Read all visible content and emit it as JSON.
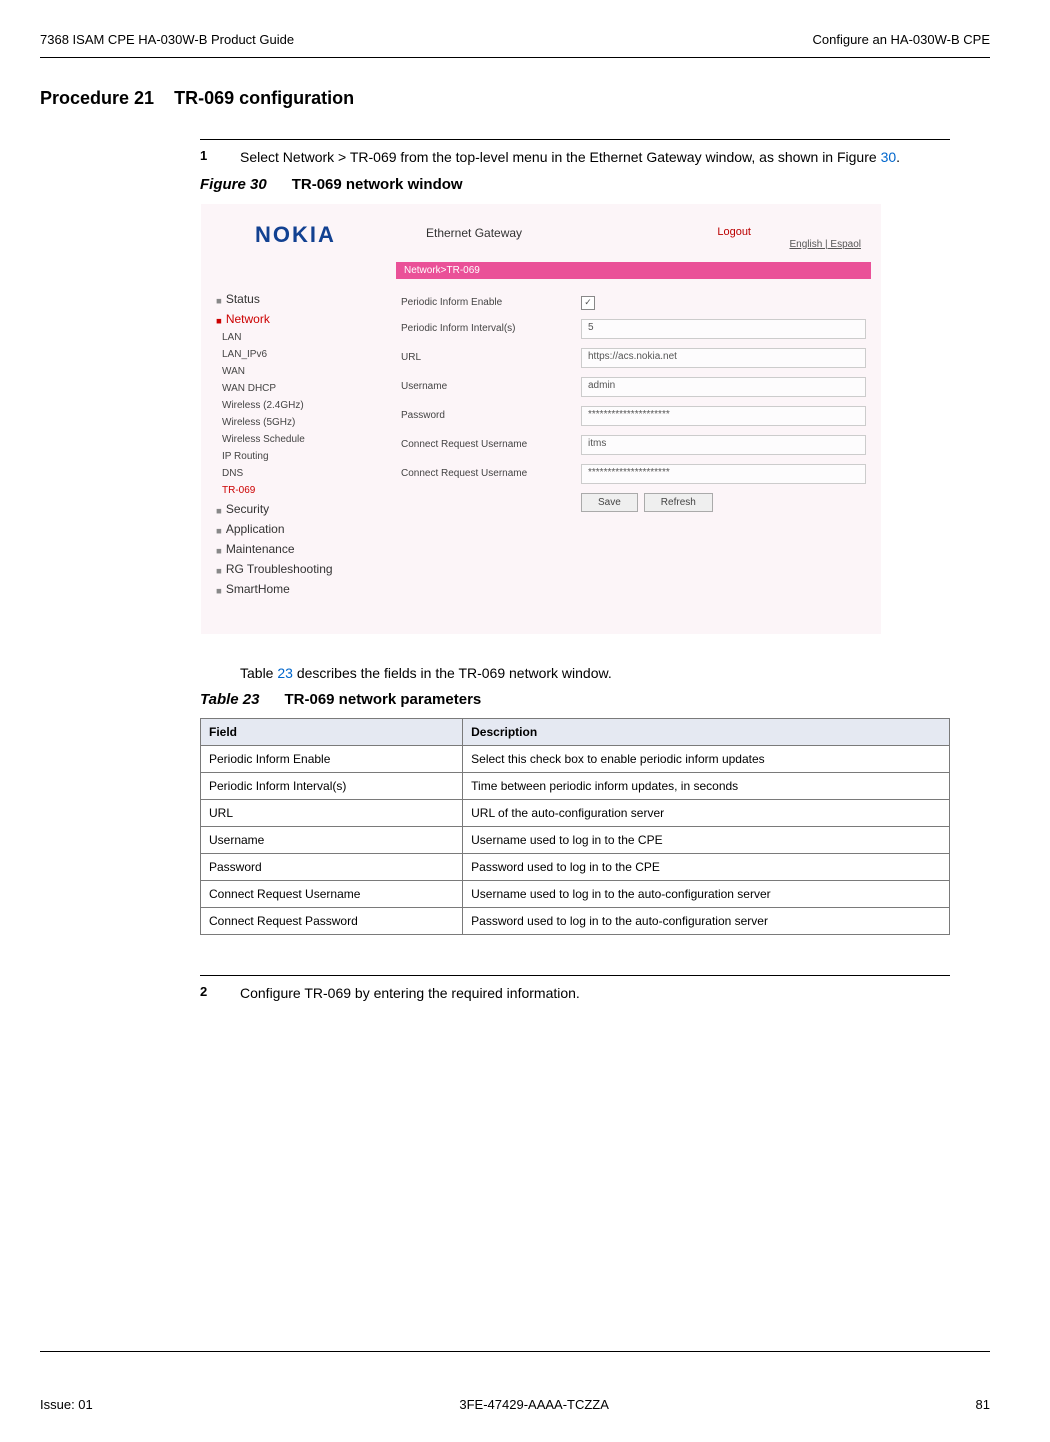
{
  "header": {
    "left": "7368 ISAM CPE HA-030W-B Product Guide",
    "right": "Configure an HA-030W-B CPE"
  },
  "procedure": {
    "label": "Procedure 21",
    "title": "TR-069 configuration"
  },
  "step1": {
    "num": "1",
    "text_before": "Select Network > TR-069 from the top-level menu in the Ethernet Gateway window, as shown in Figure ",
    "ref": "30",
    "text_after": "."
  },
  "figure": {
    "label": "Figure 30",
    "title": "TR-069 network window"
  },
  "screenshot": {
    "logo": "NOKIA",
    "header_title": "Ethernet Gateway",
    "logout": "Logout",
    "lang": "English | Espaol",
    "breadcrumb": "Network>TR-069",
    "side": {
      "status": "Status",
      "network": "Network",
      "items": [
        "LAN",
        "LAN_IPv6",
        "WAN",
        "WAN DHCP",
        "Wireless (2.4GHz)",
        "Wireless (5GHz)",
        "Wireless Schedule",
        "IP Routing",
        "DNS",
        "TR-069"
      ],
      "security": "Security",
      "application": "Application",
      "maintenance": "Maintenance",
      "rg": "RG Troubleshooting",
      "smarthome": "SmartHome"
    },
    "form": {
      "periodic_enable_label": "Periodic Inform Enable",
      "periodic_enable_value": "✓",
      "periodic_interval_label": "Periodic Inform Interval(s)",
      "periodic_interval_value": "5",
      "url_label": "URL",
      "url_value": "https://acs.nokia.net",
      "username_label": "Username",
      "username_value": "admin",
      "password_label": "Password",
      "password_value": "*********************",
      "cr_user_label": "Connect Request Username",
      "cr_user_value": "itms",
      "cr_pass_label": "Connect Request Username",
      "cr_pass_value": "*********************",
      "save": "Save",
      "refresh": "Refresh"
    }
  },
  "table_intro_before": "Table ",
  "table_intro_ref": "23",
  "table_intro_after": " describes the fields in the TR-069 network window.",
  "table_caption": {
    "label": "Table 23",
    "title": "TR-069 network parameters"
  },
  "table_headers": {
    "field": "Field",
    "desc": "Description"
  },
  "table_rows": [
    {
      "field": "Periodic Inform Enable",
      "desc": "Select this check box to enable periodic inform updates"
    },
    {
      "field": "Periodic Inform Interval(s)",
      "desc": "Time between periodic inform updates, in seconds"
    },
    {
      "field": "URL",
      "desc": "URL of the auto-configuration server"
    },
    {
      "field": "Username",
      "desc": "Username used to log in to the CPE"
    },
    {
      "field": "Password",
      "desc": "Password used to log in to the CPE"
    },
    {
      "field": "Connect Request Username",
      "desc": "Username used to log in to the auto-configuration server"
    },
    {
      "field": "Connect Request Password",
      "desc": "Password used to log in to the auto-configuration server"
    }
  ],
  "step2": {
    "num": "2",
    "text": "Configure TR-069 by entering the required information."
  },
  "footer": {
    "left": "Issue: 01",
    "center": "3FE-47429-AAAA-TCZZA",
    "right": "81"
  }
}
